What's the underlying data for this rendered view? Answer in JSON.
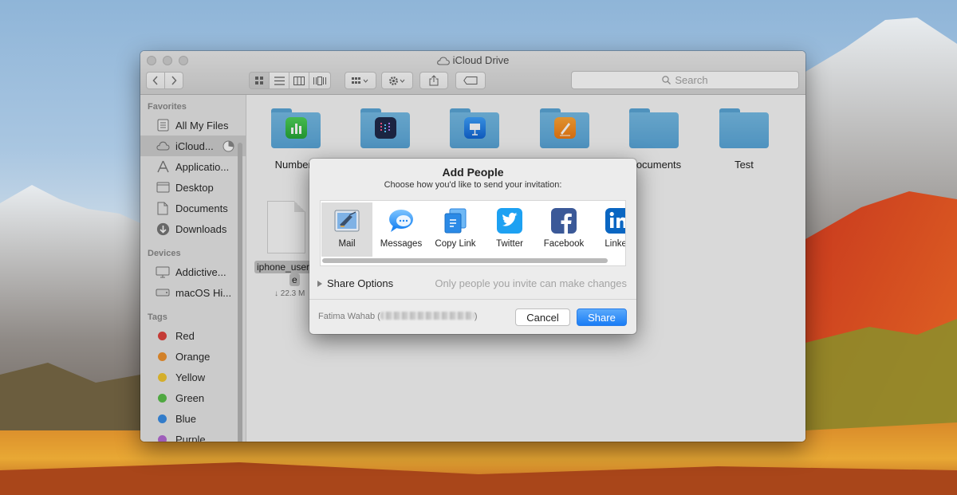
{
  "window": {
    "title": "iCloud Drive"
  },
  "toolbar": {
    "back_icon": "chevron-left",
    "forward_icon": "chevron-right",
    "view_modes": [
      "icon-view",
      "list-view",
      "column-view",
      "cover-flow-view"
    ],
    "search_placeholder": "Search"
  },
  "sidebar": {
    "favorites_heading": "Favorites",
    "favorites": [
      {
        "label": "All My Files",
        "icon": "all-files-icon"
      },
      {
        "label": "iCloud...",
        "icon": "cloud-icon",
        "selected": true
      },
      {
        "label": "Applicatio...",
        "icon": "applications-icon"
      },
      {
        "label": "Desktop",
        "icon": "desktop-icon"
      },
      {
        "label": "Documents",
        "icon": "documents-icon"
      },
      {
        "label": "Downloads",
        "icon": "downloads-icon"
      }
    ],
    "devices_heading": "Devices",
    "devices": [
      {
        "label": "Addictive...",
        "icon": "computer-icon"
      },
      {
        "label": "macOS Hi...",
        "icon": "disk-icon"
      }
    ],
    "tags_heading": "Tags",
    "tags": [
      {
        "label": "Red",
        "color": "#e0443e"
      },
      {
        "label": "Orange",
        "color": "#f0932f"
      },
      {
        "label": "Yellow",
        "color": "#f2c731"
      },
      {
        "label": "Green",
        "color": "#5ac04a"
      },
      {
        "label": "Blue",
        "color": "#3a8ee6"
      },
      {
        "label": "Purple",
        "color": "#b46ad4"
      }
    ]
  },
  "content": {
    "folders": [
      {
        "label": "Numbers"
      },
      {
        "label": ""
      },
      {
        "label": ""
      },
      {
        "label": ""
      },
      {
        "label": "ocuments"
      },
      {
        "label": "Test"
      }
    ],
    "file": {
      "name_line1": "iphone_user",
      "name_line2": "e",
      "size": "↓ 22.3 M"
    }
  },
  "dialog": {
    "title": "Add People",
    "subtitle": "Choose how you'd like to send your invitation:",
    "services": [
      {
        "label": "Mail",
        "icon": "mail-icon",
        "selected": true
      },
      {
        "label": "Messages",
        "icon": "messages-icon"
      },
      {
        "label": "Copy Link",
        "icon": "copy-link-icon"
      },
      {
        "label": "Twitter",
        "icon": "twitter-icon"
      },
      {
        "label": "Facebook",
        "icon": "facebook-icon"
      },
      {
        "label": "Linkec",
        "icon": "linkedin-icon"
      }
    ],
    "share_options_label": "Share Options",
    "permission_text": "Only people you invite can make changes",
    "owner_name": "Fatima Wahab (",
    "owner_suffix": ")",
    "cancel_label": "Cancel",
    "share_label": "Share"
  }
}
